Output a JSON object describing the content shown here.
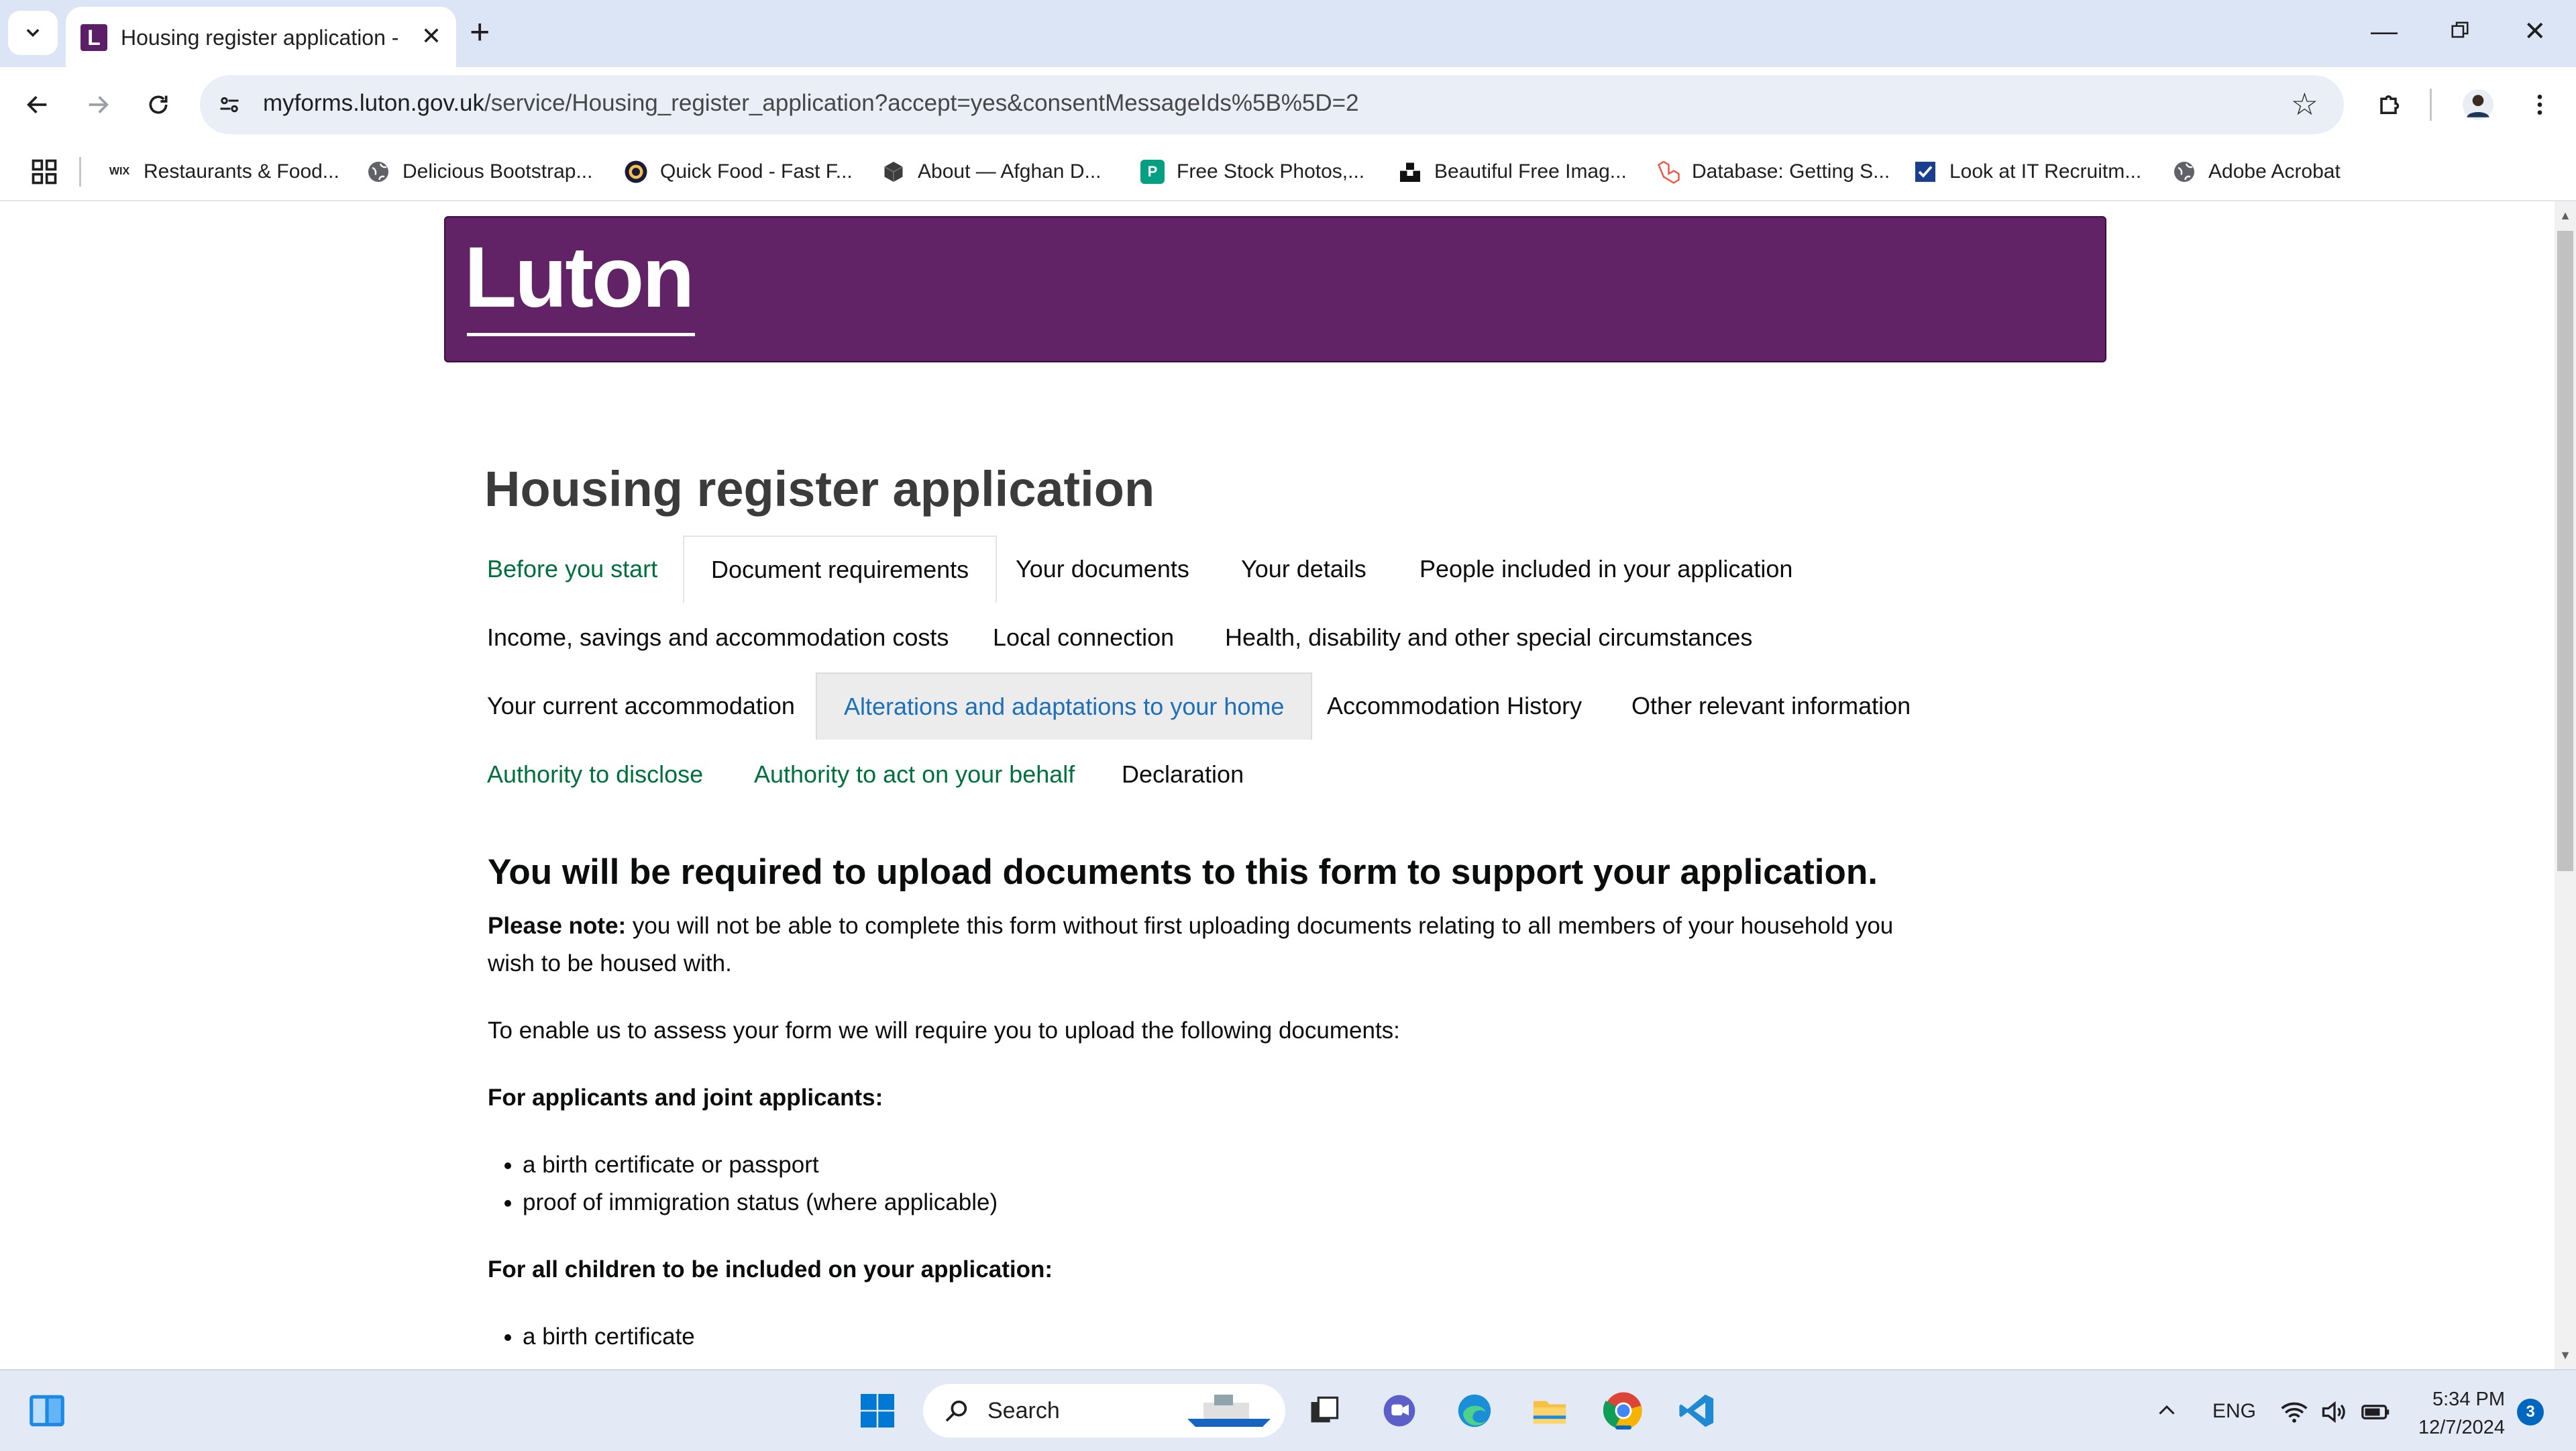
{
  "browser": {
    "tab_title": "Housing register application - D",
    "url_host": "myforms.luton.gov.uk",
    "url_path": "/service/Housing_register_application?accept=yes&consentMessageIds%5B%5D=2",
    "tab_favicon_letter": "L",
    "bookmarks": [
      {
        "label": "Restaurants & Food...",
        "icon": "wix-icon",
        "icon_text": "WIX"
      },
      {
        "label": "Delicious Bootstrap...",
        "icon": "globe-icon"
      },
      {
        "label": "Quick Food - Fast F...",
        "icon": "quickfood-icon"
      },
      {
        "label": "About — Afghan D...",
        "icon": "cube-icon"
      },
      {
        "label": "Free Stock Photos,...",
        "icon": "pexels-icon",
        "icon_text": "P"
      },
      {
        "label": "Beautiful Free Imag...",
        "icon": "unsplash-icon"
      },
      {
        "label": "Database: Getting S...",
        "icon": "laravel-icon"
      },
      {
        "label": "Look at IT Recruitm...",
        "icon": "checkmark-icon"
      },
      {
        "label": "Adobe Acrobat",
        "icon": "globe-icon"
      }
    ]
  },
  "page": {
    "logo_text": "Luton",
    "title": "Housing register application",
    "brand_color": "#612366",
    "nav": [
      {
        "label": "Before you start",
        "state": "done"
      },
      {
        "label": "Document requirements",
        "state": "active"
      },
      {
        "label": "Your documents",
        "state": "default"
      },
      {
        "label": "Your details",
        "state": "default"
      },
      {
        "label": "People included in your application",
        "state": "default"
      },
      {
        "label": "Income, savings and accommodation costs",
        "state": "default"
      },
      {
        "label": "Local connection",
        "state": "default"
      },
      {
        "label": "Health, disability and other special circumstances",
        "state": "default"
      },
      {
        "label": "Your current accommodation",
        "state": "default"
      },
      {
        "label": "Alterations and adaptations to your home",
        "state": "current"
      },
      {
        "label": "Accommodation History",
        "state": "default"
      },
      {
        "label": "Other relevant information",
        "state": "default"
      },
      {
        "label": "Authority to disclose",
        "state": "done"
      },
      {
        "label": "Authority to act on your behalf",
        "state": "done"
      },
      {
        "label": "Declaration",
        "state": "default"
      }
    ],
    "heading": "You will be required to upload documents to this form to support your application.",
    "note_label": "Please note:",
    "note_text": " you will not be able to complete this form without first uploading documents relating to all members of your household you wish to be housed with.",
    "intro": "To enable us to assess your form we will require you to upload the following documents:",
    "section1_title": "For applicants and joint applicants:",
    "section1_items": [
      "a birth certificate or passport",
      "proof of immigration status (where applicable)"
    ],
    "section2_title": "For all children to be included on your application:",
    "section2_items": [
      "a birth certificate"
    ]
  },
  "taskbar": {
    "search_label": "Search",
    "language": "ENG",
    "time": "5:34 PM",
    "date": "12/7/2024",
    "notification_count": "3"
  }
}
